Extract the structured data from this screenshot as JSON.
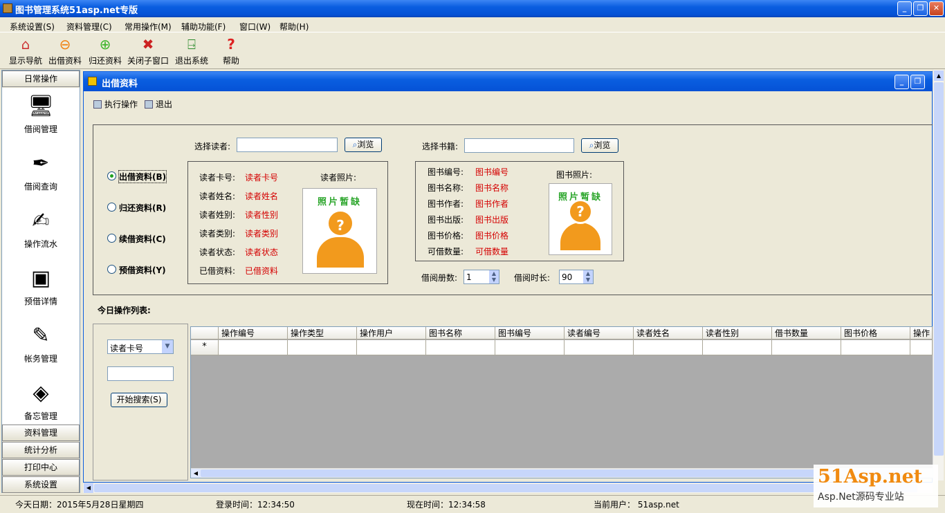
{
  "window": {
    "title": "图书管理系统51asp.net专版"
  },
  "menu": [
    "系统设置(S)",
    "资料管理(C)",
    "常用操作(M)",
    "辅助功能(F)",
    "窗口(W)",
    "帮助(H)"
  ],
  "toolbar": [
    "显示导航",
    "出借资料",
    "归还资料",
    "关闭子窗口",
    "退出系统",
    "帮助"
  ],
  "left": {
    "top_header": "日常操作",
    "items": [
      "借阅管理",
      "借阅查询",
      "操作流水",
      "预借详情",
      "帐务管理",
      "备忘管理"
    ],
    "bottom_headers": [
      "资料管理",
      "统计分析",
      "打印中心",
      "系统设置"
    ]
  },
  "child": {
    "title": "出借资料",
    "tools": [
      "执行操作",
      "退出"
    ],
    "reader_label": "选择读者:",
    "reader_value": "",
    "browse": "浏览",
    "book_label": "选择书籍:",
    "book_value": "",
    "radios": [
      "出借资料(B)",
      "归还资料(R)",
      "续借资料(C)",
      "预借资料(Y)"
    ],
    "reader_info": {
      "labels": [
        "读者卡号:",
        "读者姓名:",
        "读者姓别:",
        "读者类别:",
        "读者状态:",
        "已借资料:"
      ],
      "values": [
        "读者卡号",
        "读者姓名",
        "读者性别",
        "读者类别",
        "读者状态",
        "已借资料"
      ],
      "photo_label": "读者照片:"
    },
    "book_info": {
      "labels": [
        "图书编号:",
        "图书名称:",
        "图书作者:",
        "图书出版:",
        "图书价格:",
        "可借数量:"
      ],
      "values": [
        "图书编号",
        "图书名称",
        "图书作者",
        "图书出版",
        "图书价格",
        "可借数量"
      ],
      "photo_label": "图书照片:"
    },
    "photo_text": "照片暂缺",
    "borrow_count_label": "借阅册数:",
    "borrow_count": "1",
    "borrow_days_label": "借阅时长:",
    "borrow_days": "90",
    "today_list": "今日操作列表:",
    "search_field": "读者卡号",
    "search_button": "开始搜索(S)",
    "columns": [
      "操作编号",
      "操作类型",
      "操作用户",
      "图书名称",
      "图书编号",
      "读者编号",
      "读者姓名",
      "读者性别",
      "借书数量",
      "图书价格",
      "操作"
    ],
    "new_row_marker": "*"
  },
  "status": {
    "date": "今天日期：2015年5月28日星期四",
    "login": "登录时间：12:34:50",
    "now": "现在时间：12:34:58",
    "user": "当前用户： 51asp.net"
  },
  "watermark": {
    "line1": "51Asp.net",
    "line2": "Asp.Net源码专业站"
  },
  "colors": {
    "accent": "#0a5ee0",
    "value_red": "#d40000"
  }
}
